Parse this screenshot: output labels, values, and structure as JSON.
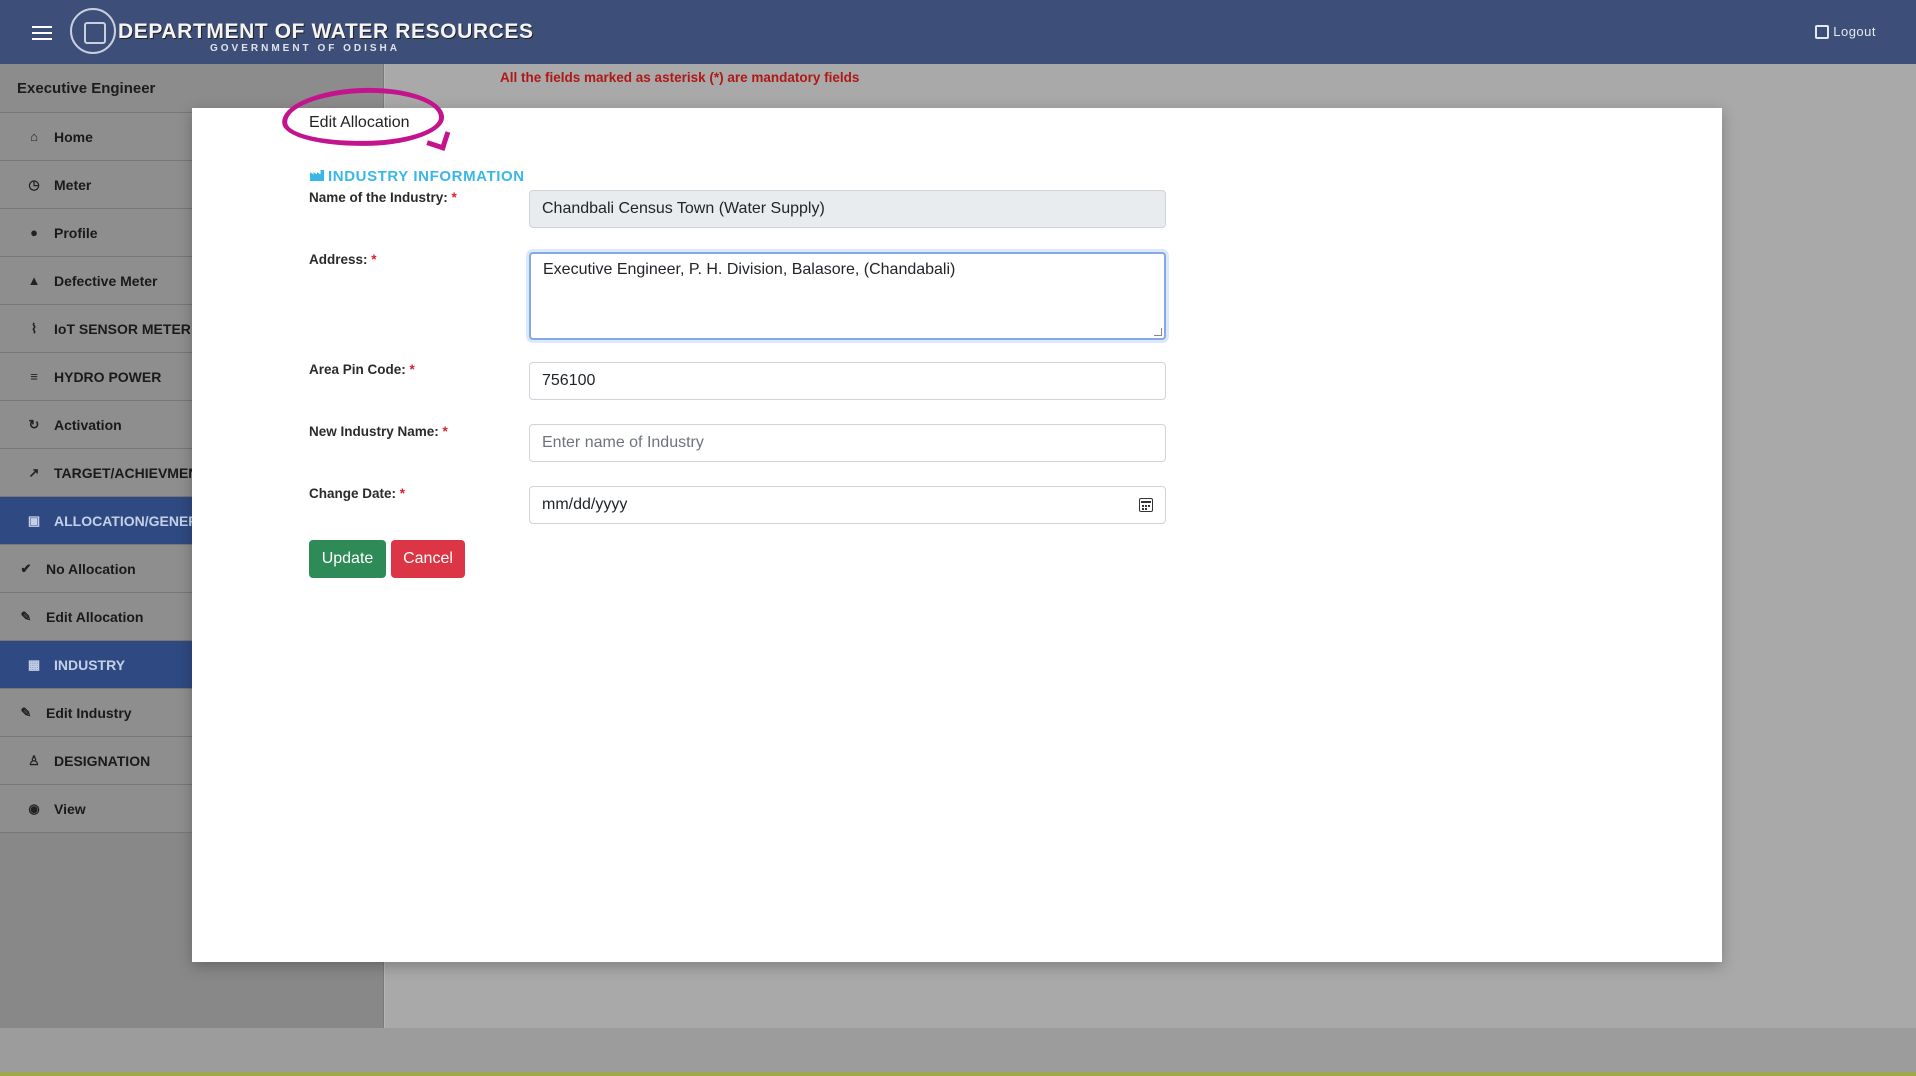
{
  "header": {
    "title": "DEPARTMENT OF WATER RESOURCES",
    "subtitle": "GOVERNMENT OF ODISHA",
    "logout_label": "Logout"
  },
  "sidebar": {
    "role": "Executive Engineer",
    "items": [
      {
        "label": "Home",
        "icon": "home-icon"
      },
      {
        "label": "Meter",
        "icon": "meter-icon"
      },
      {
        "label": "Profile",
        "icon": "user-icon"
      },
      {
        "label": "Defective Meter",
        "icon": "warning-icon"
      },
      {
        "label": "IoT SENSOR METER",
        "icon": "sensor-icon"
      },
      {
        "label": "HYDRO POWER",
        "icon": "waves-icon"
      },
      {
        "label": "Activation",
        "icon": "refresh-icon"
      },
      {
        "label": "TARGET/ACHIEVMENT",
        "icon": "trend-icon"
      },
      {
        "label": "ALLOCATION/GENERATION",
        "icon": "file-icon"
      },
      {
        "label": "No Allocation",
        "icon": "check-circle-icon"
      },
      {
        "label": "Edit Allocation",
        "icon": "edit-list-icon"
      },
      {
        "label": "INDUSTRY",
        "icon": "building-icon"
      },
      {
        "label": "Edit Industry",
        "icon": "edit-list-icon"
      },
      {
        "label": "DESIGNATION",
        "icon": "person-icon"
      },
      {
        "label": "View",
        "icon": "eye-icon"
      }
    ]
  },
  "notice": "All the fields marked as asterisk (*) are mandatory fields",
  "modal": {
    "title": "Edit Allocation",
    "section": "INDUSTRY INFORMATION",
    "fields": {
      "industry_name": {
        "label": "Name of the Industry:",
        "value": "Chandbali Census Town (Water Supply)"
      },
      "address": {
        "label": "Address:",
        "value": "Executive Engineer, P. H. Division, Balasore, (Chandabali)"
      },
      "pin": {
        "label": "Area Pin Code:",
        "value": "756100"
      },
      "new_name": {
        "label": "New Industry Name:",
        "placeholder": "Enter name of Industry"
      },
      "change_date": {
        "label": "Change Date:",
        "placeholder": "mm/dd/yyyy"
      }
    },
    "required_mark": "*",
    "update_label": "Update",
    "cancel_label": "Cancel"
  },
  "colors": {
    "header_bg": "#3d4f79",
    "section_bg": "#2f4a82",
    "update": "#2e8b57",
    "cancel": "#dc3545",
    "accent": "#39b8e6",
    "annotation": "#c4148d"
  }
}
